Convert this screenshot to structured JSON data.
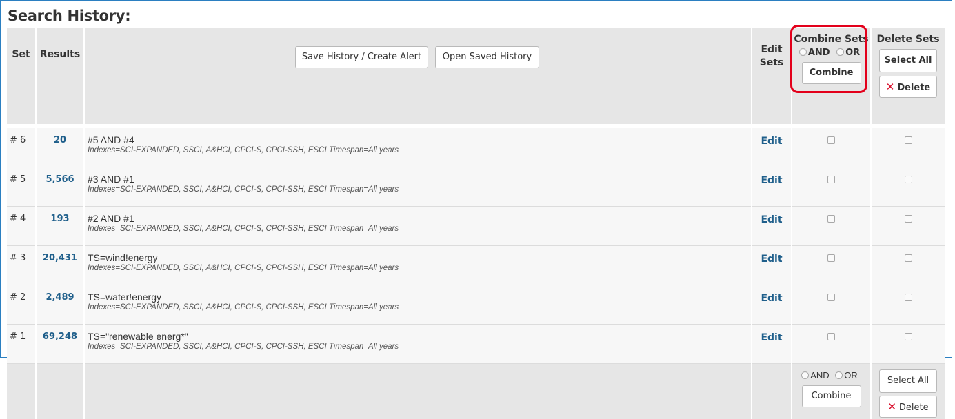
{
  "title": "Search History:",
  "header": {
    "set": "Set",
    "results": "Results",
    "save_button": "Save History / Create Alert",
    "open_button": "Open Saved History",
    "edit_sets_line1": "Edit",
    "edit_sets_line2": "Sets",
    "combine_sets": "Combine Sets",
    "and_label": "AND",
    "or_label": "OR",
    "combine_button": "Combine",
    "delete_sets": "Delete Sets",
    "select_all_button": "Select All",
    "delete_button": "Delete"
  },
  "rows": [
    {
      "set": "# 6",
      "results": "20",
      "query": "#5 AND #4",
      "meta": "Indexes=SCI-EXPANDED, SSCI, A&HCI, CPCI-S, CPCI-SSH, ESCI Timespan=All years",
      "edit": "Edit"
    },
    {
      "set": "# 5",
      "results": "5,566",
      "query": "#3 AND #1",
      "meta": "Indexes=SCI-EXPANDED, SSCI, A&HCI, CPCI-S, CPCI-SSH, ESCI Timespan=All years",
      "edit": "Edit"
    },
    {
      "set": "# 4",
      "results": "193",
      "query": "#2 AND #1",
      "meta": "Indexes=SCI-EXPANDED, SSCI, A&HCI, CPCI-S, CPCI-SSH, ESCI Timespan=All years",
      "edit": "Edit"
    },
    {
      "set": "# 3",
      "results": "20,431",
      "query": "TS=wind!energy",
      "meta": "Indexes=SCI-EXPANDED, SSCI, A&HCI, CPCI-S, CPCI-SSH, ESCI Timespan=All years",
      "edit": "Edit"
    },
    {
      "set": "# 2",
      "results": "2,489",
      "query": "TS=water!energy",
      "meta": "Indexes=SCI-EXPANDED, SSCI, A&HCI, CPCI-S, CPCI-SSH, ESCI Timespan=All years",
      "edit": "Edit"
    },
    {
      "set": "# 1",
      "results": "69,248",
      "query": "TS=\"renewable energ*\"",
      "meta": "Indexes=SCI-EXPANDED, SSCI, A&HCI, CPCI-S, CPCI-SSH, ESCI Timespan=All years",
      "edit": "Edit"
    }
  ],
  "footer": {
    "and_label": "AND",
    "or_label": "OR",
    "combine_button": "Combine",
    "select_all_button": "Select All",
    "delete_button": "Delete"
  },
  "colors": {
    "link": "#1f5f8b",
    "border": "#2b7fc1",
    "highlight": "#e3001b",
    "delete_x": "#d9112e",
    "header_bg": "#e6e6e6"
  }
}
